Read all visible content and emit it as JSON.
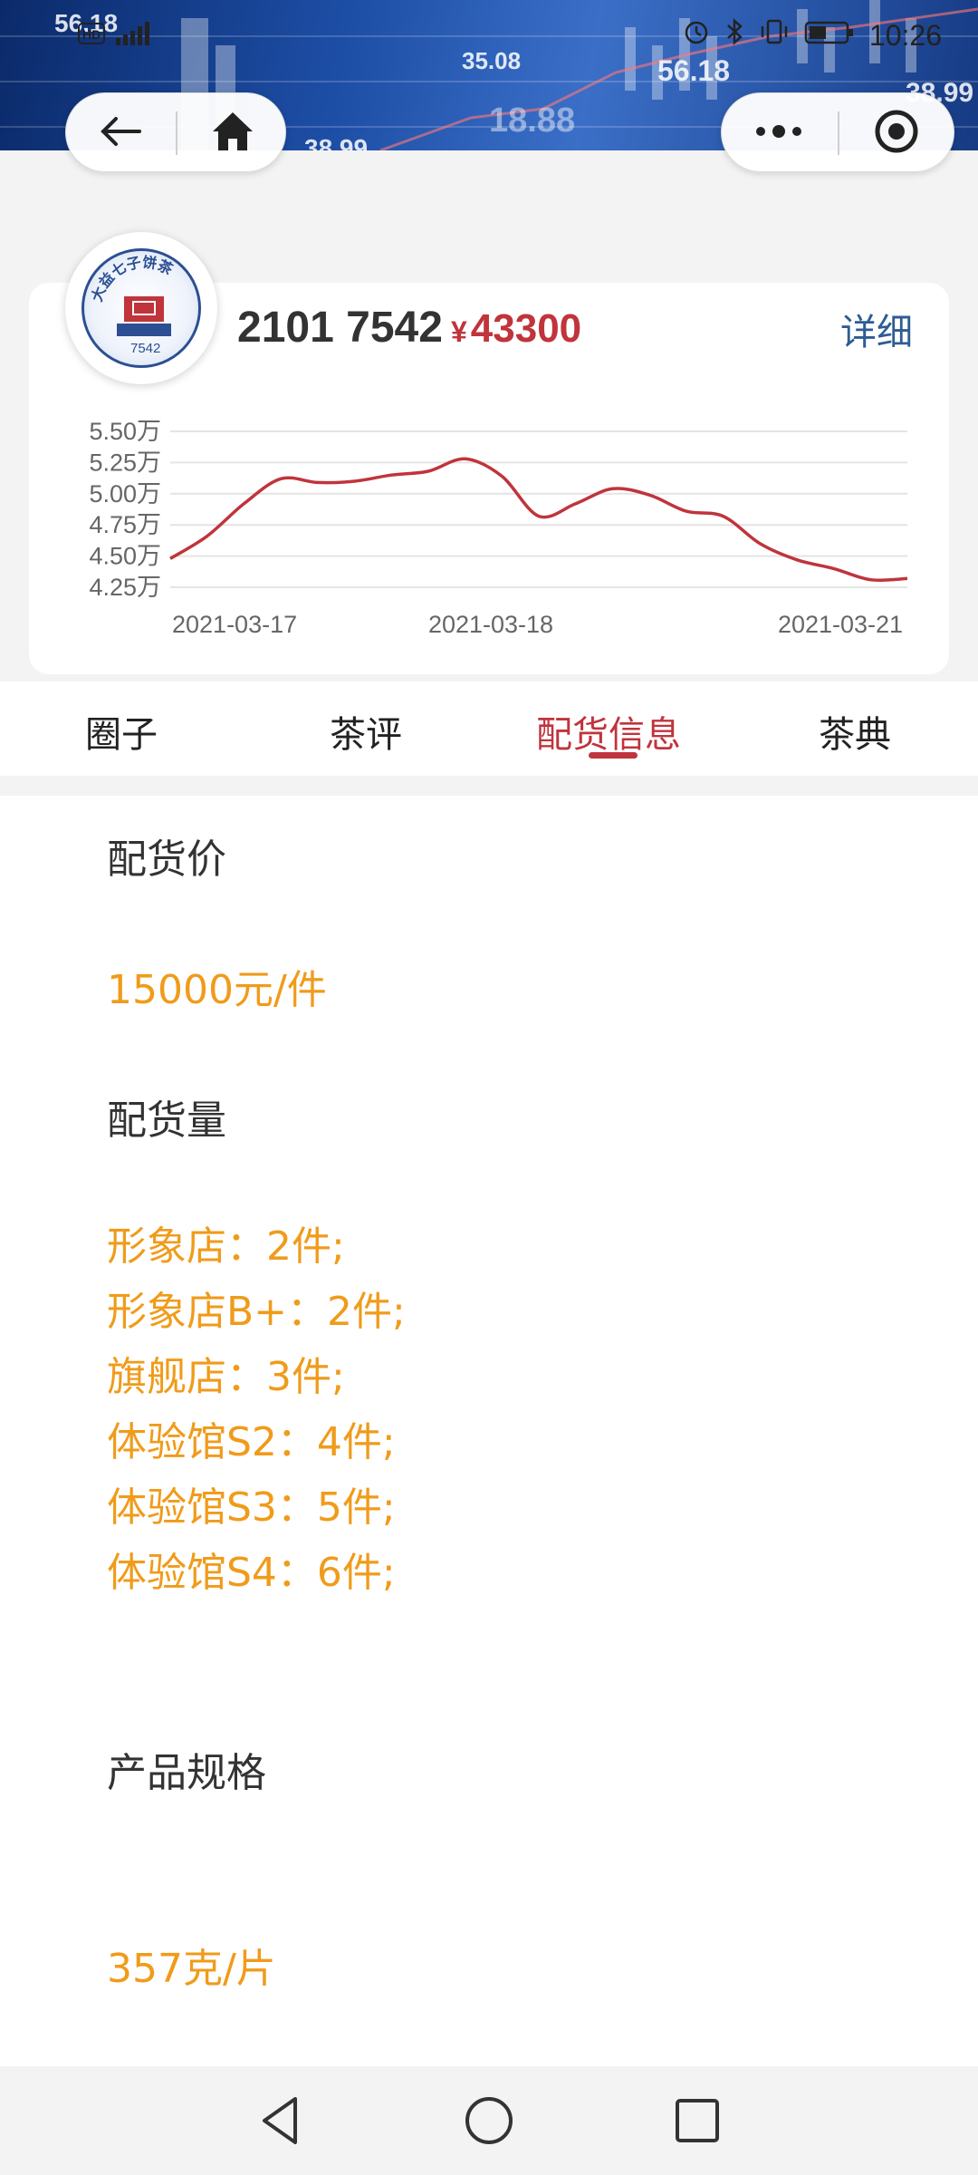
{
  "banner_numbers": [
    "56.18",
    "35.08",
    "56.18",
    "38.99",
    "18.88",
    "38.99"
  ],
  "status": {
    "time": "10:26"
  },
  "product": {
    "code": "2101 7542",
    "currency": "¥",
    "price": "43300",
    "detail_label": "详细",
    "logo_text": "大益七子饼茶",
    "logo_number": "7542"
  },
  "chart_data": {
    "type": "line",
    "x_labels": [
      "2021-03-17",
      "2021-03-18",
      "2021-03-21"
    ],
    "y_ticks": [
      "5.50万",
      "5.25万",
      "5.00万",
      "4.75万",
      "4.50万",
      "4.25万"
    ],
    "ylim": [
      42500,
      55000
    ],
    "values": [
      44800,
      46600,
      49200,
      51200,
      50900,
      51000,
      51500,
      51800,
      52800,
      51400,
      48200,
      49200,
      50400,
      49900,
      48600,
      48200,
      46000,
      44700,
      44000,
      43100,
      43200
    ],
    "grid": true,
    "color": "#c0343c"
  },
  "tabs": [
    {
      "label": "圈子",
      "active": false
    },
    {
      "label": "茶评",
      "active": false
    },
    {
      "label": "配货信息",
      "active": true
    },
    {
      "label": "茶典",
      "active": false
    }
  ],
  "content": {
    "price_label": "配货价",
    "price_value": "15000元/件",
    "quantity_label": "配货量",
    "quantities": [
      "形象店：2件;",
      "形象店B+：2件;",
      "旗舰店：3件;",
      "体验馆S2：4件;",
      "体验馆S3：5件;",
      "体验馆S4：6件;"
    ],
    "spec_label": "产品规格",
    "spec_value": "357克/片"
  },
  "colors": {
    "accent": "#c0343c",
    "value": "#f09b1a",
    "link": "#2e5c93"
  }
}
